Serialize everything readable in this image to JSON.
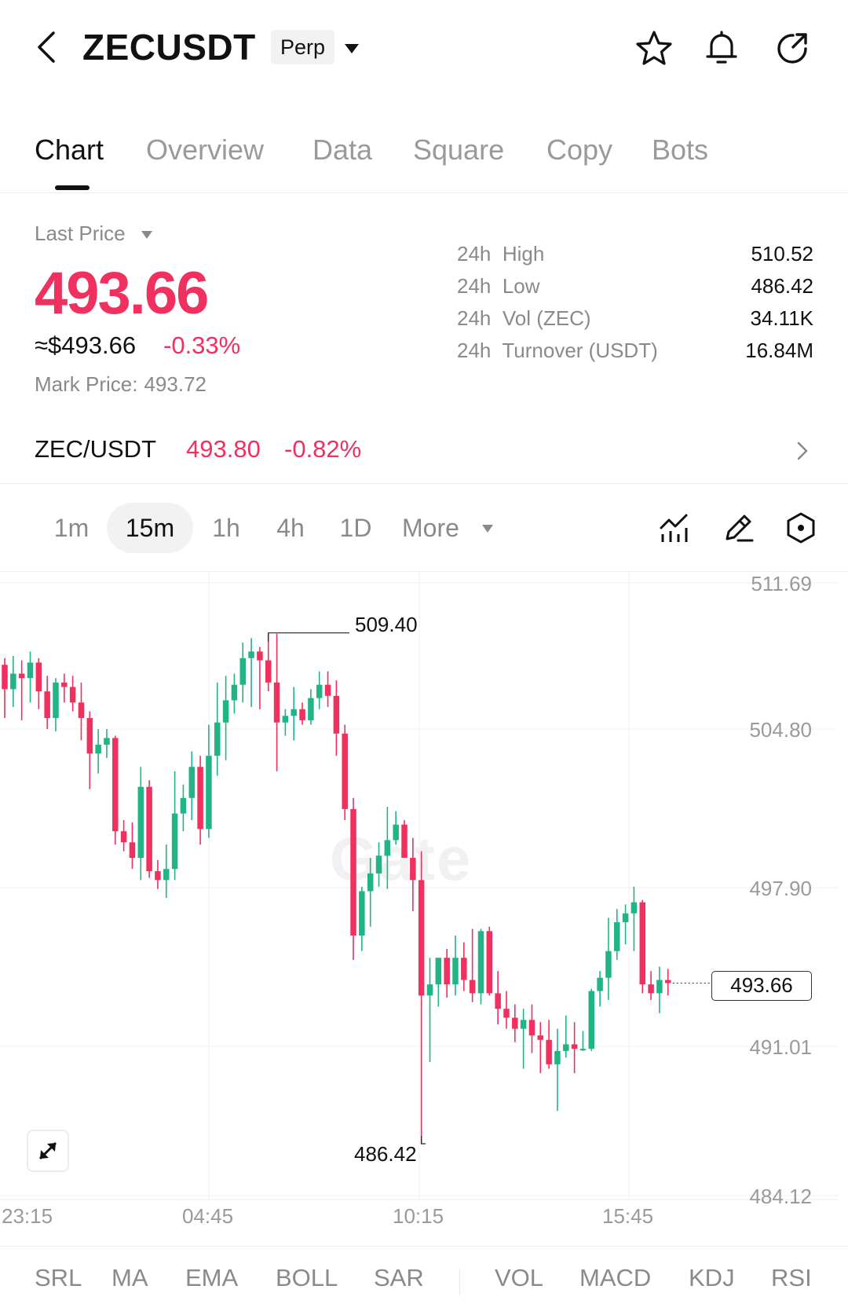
{
  "header": {
    "symbol": "ZECUSDT",
    "contract_type": "Perp",
    "icons": [
      "back-icon",
      "star-icon",
      "bell-icon",
      "share-icon"
    ]
  },
  "tabs": [
    {
      "label": "Chart",
      "active": true
    },
    {
      "label": "Overview",
      "active": false
    },
    {
      "label": "Data",
      "active": false
    },
    {
      "label": "Square",
      "active": false
    },
    {
      "label": "Copy",
      "active": false
    },
    {
      "label": "Bots",
      "active": false
    }
  ],
  "price": {
    "label": "Last Price",
    "value": "493.66",
    "approx": "≈$493.66",
    "change": "-0.33%",
    "mark_label": "Mark Price:",
    "mark_value": "493.72"
  },
  "stats": [
    {
      "label": "24h  High",
      "value": "510.52"
    },
    {
      "label": "24h  Low",
      "value": "486.42"
    },
    {
      "label": "24h  Vol (ZEC)",
      "value": "34.11K"
    },
    {
      "label": "24h  Turnover (USDT)",
      "value": "16.84M"
    }
  ],
  "spot": {
    "pair": "ZEC/USDT",
    "price": "493.80",
    "change": "-0.82%"
  },
  "timeframes": [
    {
      "label": "1m",
      "active": false
    },
    {
      "label": "15m",
      "active": true
    },
    {
      "label": "1h",
      "active": false
    },
    {
      "label": "4h",
      "active": false
    },
    {
      "label": "1D",
      "active": false
    },
    {
      "label": "More",
      "active": false
    }
  ],
  "colors": {
    "up": "#20b486",
    "down": "#f0305f",
    "muted": "#8a8a8a"
  },
  "chart_data": {
    "type": "candlestick",
    "interval": "15m",
    "watermark": "Gate",
    "y_ticks": [
      "511.69",
      "504.80",
      "497.90",
      "491.01",
      "484.12"
    ],
    "ylim": [
      484.12,
      511.69
    ],
    "x_ticks": [
      "23:15",
      "04:45",
      "10:15",
      "15:45"
    ],
    "last_price_tag": "493.66",
    "high_label": "509.40",
    "low_label": "486.42",
    "candles": [
      [
        508.0,
        508.3,
        505.6,
        506.9
      ],
      [
        506.9,
        508.4,
        506.1,
        507.6
      ],
      [
        507.6,
        508.2,
        505.5,
        507.4
      ],
      [
        507.4,
        508.6,
        506.3,
        508.1
      ],
      [
        508.1,
        508.3,
        506.0,
        506.8
      ],
      [
        506.8,
        507.5,
        505.1,
        505.6
      ],
      [
        505.6,
        507.4,
        505.0,
        507.2
      ],
      [
        507.2,
        507.6,
        506.3,
        507.0
      ],
      [
        507.0,
        507.5,
        505.9,
        506.3
      ],
      [
        506.3,
        507.2,
        504.6,
        505.6
      ],
      [
        505.6,
        505.9,
        502.4,
        504.0
      ],
      [
        504.0,
        505.1,
        503.1,
        504.4
      ],
      [
        504.4,
        505.1,
        503.8,
        504.7
      ],
      [
        504.7,
        504.8,
        499.9,
        500.5
      ],
      [
        500.5,
        501.0,
        499.6,
        500.0
      ],
      [
        500.0,
        500.9,
        498.8,
        499.3
      ],
      [
        499.3,
        503.4,
        498.3,
        502.5
      ],
      [
        502.5,
        502.8,
        498.4,
        498.7
      ],
      [
        498.7,
        499.2,
        497.9,
        498.3
      ],
      [
        498.3,
        499.9,
        497.5,
        498.8
      ],
      [
        498.8,
        503.2,
        498.3,
        501.3
      ],
      [
        501.3,
        502.6,
        500.5,
        502.0
      ],
      [
        502.0,
        504.1,
        501.0,
        503.4
      ],
      [
        503.4,
        503.9,
        499.9,
        500.6
      ],
      [
        500.6,
        505.3,
        500.2,
        503.9
      ],
      [
        503.9,
        507.2,
        503.0,
        505.4
      ],
      [
        505.4,
        507.5,
        503.7,
        506.4
      ],
      [
        506.4,
        507.6,
        505.8,
        507.1
      ],
      [
        507.1,
        509.0,
        506.3,
        508.3
      ],
      [
        508.3,
        509.2,
        506.1,
        508.6
      ],
      [
        508.6,
        508.8,
        506.0,
        508.2
      ],
      [
        508.2,
        509.4,
        506.8,
        507.2
      ],
      [
        507.2,
        509.4,
        503.2,
        505.4
      ],
      [
        505.4,
        506.0,
        504.8,
        505.7
      ],
      [
        505.7,
        507.0,
        504.6,
        506.0
      ],
      [
        506.0,
        506.3,
        505.3,
        505.5
      ],
      [
        505.5,
        506.9,
        505.3,
        506.5
      ],
      [
        506.5,
        507.7,
        506.0,
        507.1
      ],
      [
        507.1,
        507.7,
        506.1,
        506.6
      ],
      [
        506.6,
        507.3,
        503.9,
        504.9
      ],
      [
        504.9,
        505.3,
        501.0,
        501.5
      ],
      [
        501.5,
        502.0,
        494.7,
        495.8
      ],
      [
        495.8,
        498.0,
        495.1,
        497.8
      ],
      [
        497.8,
        499.3,
        496.2,
        498.6
      ],
      [
        498.6,
        500.0,
        498.0,
        499.4
      ],
      [
        499.4,
        501.6,
        497.9,
        500.1
      ],
      [
        500.1,
        501.4,
        499.9,
        500.8
      ],
      [
        500.8,
        501.0,
        499.3,
        499.3
      ],
      [
        499.3,
        500.2,
        496.9,
        498.3
      ],
      [
        498.3,
        499.6,
        486.42,
        493.1
      ],
      [
        493.1,
        494.8,
        490.1,
        493.6
      ],
      [
        493.6,
        494.5,
        492.6,
        494.8
      ],
      [
        494.8,
        495.2,
        493.0,
        493.6
      ],
      [
        493.6,
        495.8,
        493.1,
        494.8
      ],
      [
        494.8,
        495.5,
        493.3,
        493.8
      ],
      [
        493.8,
        496.1,
        492.8,
        493.2
      ],
      [
        493.2,
        496.1,
        492.7,
        496.0
      ],
      [
        496.0,
        496.2,
        493.1,
        493.2
      ],
      [
        493.2,
        494.2,
        491.8,
        492.5
      ],
      [
        492.5,
        493.3,
        491.6,
        492.1
      ],
      [
        492.1,
        492.7,
        491.0,
        491.6
      ],
      [
        491.6,
        492.5,
        489.8,
        492.0
      ],
      [
        492.0,
        492.7,
        490.5,
        491.3
      ],
      [
        491.3,
        491.9,
        489.6,
        491.1
      ],
      [
        491.1,
        492.0,
        489.8,
        490.0
      ],
      [
        490.0,
        491.6,
        487.9,
        490.6
      ],
      [
        490.6,
        492.2,
        490.3,
        490.9
      ],
      [
        490.9,
        491.9,
        489.6,
        490.7
      ],
      [
        490.7,
        491.5,
        490.6,
        490.7
      ],
      [
        490.7,
        493.4,
        490.6,
        493.3
      ],
      [
        493.3,
        494.2,
        492.6,
        493.9
      ],
      [
        493.9,
        496.6,
        492.9,
        495.1
      ],
      [
        495.1,
        497.0,
        494.7,
        496.4
      ],
      [
        496.4,
        497.2,
        495.4,
        496.8
      ],
      [
        496.8,
        498.0,
        495.1,
        497.3
      ],
      [
        497.3,
        497.4,
        493.2,
        493.6
      ],
      [
        493.6,
        494.2,
        492.9,
        493.2
      ],
      [
        493.2,
        494.4,
        492.3,
        493.8
      ],
      [
        493.8,
        494.3,
        493.1,
        493.66
      ]
    ]
  },
  "indicators": {
    "main": [
      "SRL",
      "MA",
      "EMA",
      "BOLL",
      "SAR"
    ],
    "sub": [
      "VOL",
      "MACD",
      "KDJ",
      "RSI"
    ]
  }
}
